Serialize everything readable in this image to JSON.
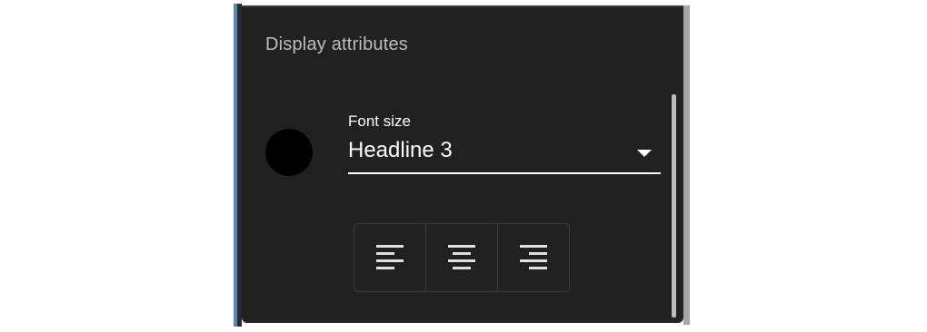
{
  "panel": {
    "title": "Display attributes"
  },
  "color_swatch": {
    "color": "#000000"
  },
  "font_size": {
    "label": "Font size",
    "value": "Headline 3",
    "icon": "chevron-down-icon"
  },
  "alignment": {
    "options": [
      {
        "name": "align-left",
        "icon": "align-left-icon"
      },
      {
        "name": "align-center",
        "icon": "align-center-icon"
      },
      {
        "name": "align-right",
        "icon": "align-right-icon"
      }
    ]
  },
  "colors": {
    "panel_bg": "#212121",
    "text_primary": "#ffffff",
    "text_secondary": "#bdbdbd",
    "accent": "#5b86c5"
  }
}
